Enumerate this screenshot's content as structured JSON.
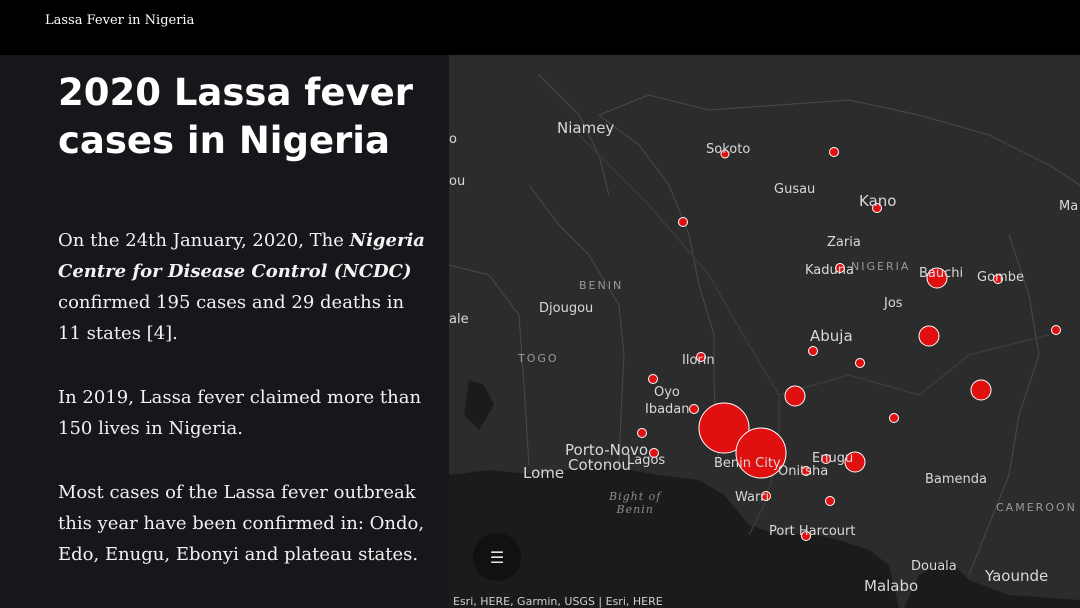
{
  "app": {
    "title": "Lassa Fever in Nigeria"
  },
  "panel": {
    "headline": "2020 Lassa fever cases  in Nigeria",
    "p1_before": "On the 24th January, 2020, The ",
    "p1_em": "Nigeria Centre for Disease Control (NCDC)",
    "p1_after": " confirmed 195 cases and 29 deaths in 11 states [4].",
    "p2": "In 2019, Lassa fever claimed more than 150 lives in Nigeria.",
    "p3": "Most cases of the Lassa fever outbreak this year have been confirmed in: Ondo, Edo, Enugu, Ebonyi and plateau states."
  },
  "map": {
    "cities": {
      "niamey": "Niamey",
      "sokoto": "Sokoto",
      "gusau": "Gusau",
      "kano": "Kano",
      "zaria": "Zaria",
      "kaduna": "Kaduna",
      "bauchi": "Bauchi",
      "gombe": "Gombe",
      "jos": "Jos",
      "abuja": "Abuja",
      "djougou": "Djougou",
      "ilorin": "Ilorin",
      "oyo": "Oyo",
      "ibadan": "Ibadan",
      "porto_novo": "Porto-Novo",
      "cotonou": "Cotonou",
      "lagos": "Lagos",
      "lome": "Lome",
      "benin_city": "Benin City",
      "enugu": "Enugu",
      "onitsha": "Onitsha",
      "warri": "Warri",
      "port_harcourt": "Port Harcourt",
      "bamenda": "Bamenda",
      "douala": "Douala",
      "malabo": "Malabo",
      "yaounde": "Yaounde",
      "edge_o": "o",
      "edge_ou": "ou",
      "edge_ale": "ale",
      "edge_ma": "Ma"
    },
    "countries": {
      "benin": "BENIN",
      "togo": "TOGO",
      "nigeria": "NIGERIA",
      "cameroon": "CAMEROON"
    },
    "water": {
      "bight": "Bight of\nBenin"
    },
    "attribution": "Esri, HERE, Garmin, USGS | Esri, HERE",
    "legend_icon": "list-icon",
    "case_color": "#e01010"
  }
}
